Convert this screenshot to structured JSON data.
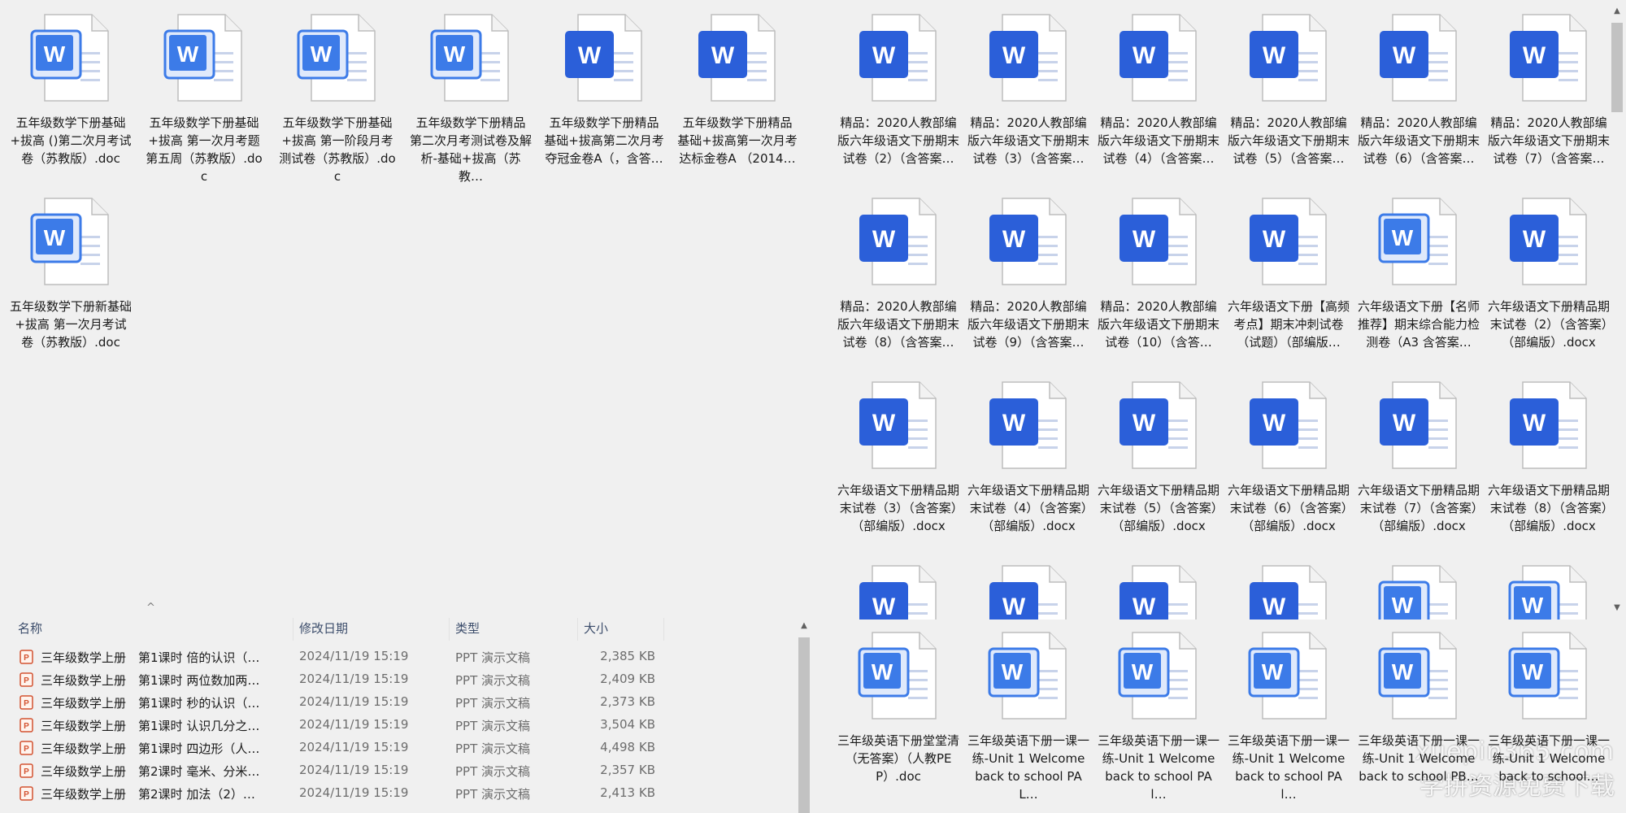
{
  "left_top_icons": [
    {
      "name": "五年级数学下册基础+拔高 ()第二次月考试卷（苏教版）.doc",
      "style": "outline"
    },
    {
      "name": "五年级数学下册基础+拔高 第一次月考题第五周（苏教版）.doc",
      "style": "outline"
    },
    {
      "name": "五年级数学下册基础+拔高 第一阶段月考测试卷（苏教版）.doc",
      "style": "outline"
    },
    {
      "name": "五年级数学下册精品 第二次月考测试卷及解析-基础+拔高（苏教…",
      "style": "outline"
    },
    {
      "name": "五年级数学下册精品 基础+拔高第二次月考夺冠金卷A（，含答…",
      "style": "solid"
    },
    {
      "name": "五年级数学下册精品 基础+拔高第一次月考达标金卷A （2014…",
      "style": "solid"
    },
    {
      "name": "五年级数学下册新基础+拔高 第一次月考试卷（苏教版）.doc",
      "style": "outline"
    }
  ],
  "right_top_icons": [
    {
      "name": "精品：2020人教部编版六年级语文下册期末试卷（2）（含答案…",
      "style": "solid"
    },
    {
      "name": "精品：2020人教部编版六年级语文下册期末试卷（3）（含答案…",
      "style": "solid"
    },
    {
      "name": "精品：2020人教部编版六年级语文下册期末试卷（4）（含答案…",
      "style": "solid"
    },
    {
      "name": "精品：2020人教部编版六年级语文下册期末试卷（5）（含答案…",
      "style": "solid"
    },
    {
      "name": "精品：2020人教部编版六年级语文下册期末试卷（6）（含答案…",
      "style": "solid"
    },
    {
      "name": "精品：2020人教部编版六年级语文下册期末试卷（7）（含答案…",
      "style": "solid"
    },
    {
      "name": "精品：2020人教部编版六年级语文下册期末试卷（8）（含答案…",
      "style": "solid"
    },
    {
      "name": "精品：2020人教部编版六年级语文下册期末试卷（9）（含答案…",
      "style": "solid"
    },
    {
      "name": "精品：2020人教部编版六年级语文下册期末试卷（10）（含答…",
      "style": "solid"
    },
    {
      "name": "六年级语文下册【高频考点】期末冲刺试卷（试题）（部编版…",
      "style": "solid"
    },
    {
      "name": "六年级语文下册【名师推荐】期末综合能力检测卷（A3 含答案…",
      "style": "outline"
    },
    {
      "name": "六年级语文下册精品期末试卷（2）（含答案）（部编版）.docx",
      "style": "solid"
    },
    {
      "name": "六年级语文下册精品期末试卷（3）（含答案）（部编版）.docx",
      "style": "solid"
    },
    {
      "name": "六年级语文下册精品期末试卷（4）（含答案）（部编版）.docx",
      "style": "solid"
    },
    {
      "name": "六年级语文下册精品期末试卷（5）（含答案）（部编版）.docx",
      "style": "solid"
    },
    {
      "name": "六年级语文下册精品期末试卷（6）（含答案）（部编版）.docx",
      "style": "solid"
    },
    {
      "name": "六年级语文下册精品期末试卷（7）（含答案）（部编版）.docx",
      "style": "solid"
    },
    {
      "name": "六年级语文下册精品期末试卷（8）（含答案）（部编版）.docx",
      "style": "solid"
    },
    {
      "name": "",
      "style": "solid"
    },
    {
      "name": "",
      "style": "solid"
    },
    {
      "name": "",
      "style": "solid"
    },
    {
      "name": "",
      "style": "solid"
    },
    {
      "name": "",
      "style": "outline"
    },
    {
      "name": "",
      "style": "outline"
    }
  ],
  "right_bottom_icons": [
    {
      "name": "三年级英语下册堂堂清（无答案）（人教PEP）.doc",
      "style": "outline"
    },
    {
      "name": "三年级英语下册一课一练-Unit 1 Welcome back to school PA L…",
      "style": "outline"
    },
    {
      "name": "三年级英语下册一课一练-Unit 1 Welcome back to school PA l…",
      "style": "outline"
    },
    {
      "name": "三年级英语下册一课一练-Unit 1 Welcome back to school PA l…",
      "style": "outline"
    },
    {
      "name": "三年级英语下册一课一练-Unit 1 Welcome back to school PB…",
      "style": "outline"
    },
    {
      "name": "三年级英语下册一课一练-Unit 1 Welcome back to school…",
      "style": "outline"
    }
  ],
  "details": {
    "headers": {
      "name": "名称",
      "date": "修改日期",
      "type": "类型",
      "size": "大小"
    },
    "sort_indicator": "^",
    "rows": [
      {
        "name": "三年级数学上册　第1课时 倍的认识（…",
        "date": "2024/11/19 15:19",
        "type": "PPT 演示文稿",
        "size": "2,385 KB"
      },
      {
        "name": "三年级数学上册　第1课时 两位数加两…",
        "date": "2024/11/19 15:19",
        "type": "PPT 演示文稿",
        "size": "2,409 KB"
      },
      {
        "name": "三年级数学上册　第1课时 秒的认识（…",
        "date": "2024/11/19 15:19",
        "type": "PPT 演示文稿",
        "size": "2,373 KB"
      },
      {
        "name": "三年级数学上册　第1课时 认识几分之…",
        "date": "2024/11/19 15:19",
        "type": "PPT 演示文稿",
        "size": "3,504 KB"
      },
      {
        "name": "三年级数学上册　第1课时 四边形（人…",
        "date": "2024/11/19 15:19",
        "type": "PPT 演示文稿",
        "size": "4,498 KB"
      },
      {
        "name": "三年级数学上册　第2课时 毫米、分米…",
        "date": "2024/11/19 15:19",
        "type": "PPT 演示文稿",
        "size": "2,357 KB"
      },
      {
        "name": "三年级数学上册　第2课时 加法（2）…",
        "date": "2024/11/19 15:19",
        "type": "PPT 演示文稿",
        "size": "2,413 KB"
      }
    ]
  },
  "watermark": {
    "line1": "xuepin365.com",
    "line2": "学拼资源免费下载"
  },
  "colors": {
    "word_blue": "#2b5fd9",
    "word_blue_light": "#3c7be8",
    "page_bg": "#f0f0f0",
    "ppt_orange": "#d35230"
  }
}
